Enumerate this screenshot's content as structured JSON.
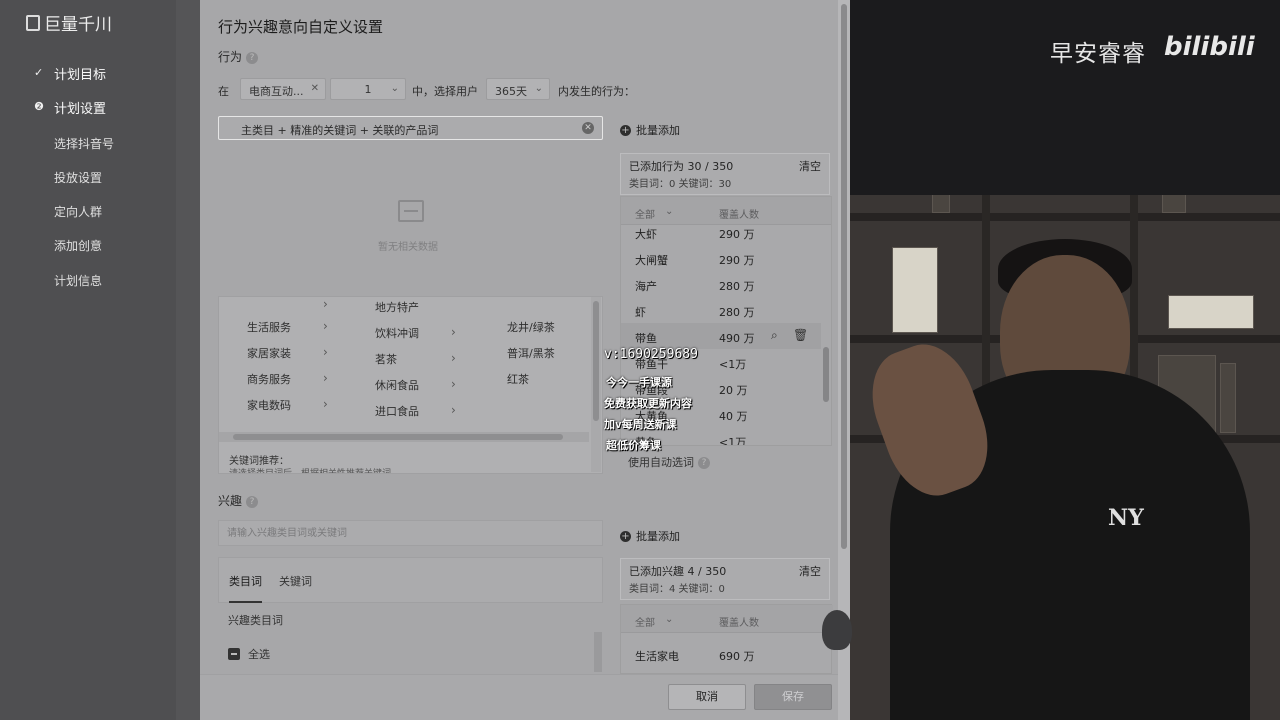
{
  "app": {
    "logo": "巨量千川",
    "nav": [
      {
        "label": "计划目标",
        "icon": "check-icon"
      },
      {
        "label": "计划设置",
        "icon": "step-2-icon"
      },
      {
        "label": "选择抖音号"
      },
      {
        "label": "投放设置"
      },
      {
        "label": "定向人群"
      },
      {
        "label": "添加创意"
      },
      {
        "label": "计划信息"
      }
    ]
  },
  "modal": {
    "title": "行为兴趣意向自定义设置",
    "behavior": {
      "label": "行为",
      "prefix": "在",
      "scene_select": "电商互动...",
      "days_select": "1",
      "mid_text": "中，选择用户",
      "period_select": "365天",
      "suffix": "内发生的行为：",
      "keyword_value": "主类目 + 精准的关键词 + 关联的产品词",
      "batch_add": "批量添加",
      "empty_text": "暂无相关数据",
      "categories": {
        "col1": [
          "生活服务",
          "家居家装",
          "商务服务",
          "家电数码"
        ],
        "col2": [
          "地方特产",
          "饮料冲调",
          "茗茶",
          "休闲食品",
          "进口食品"
        ],
        "col3": [
          "龙井/绿茶",
          "普洱/黑茶",
          "红茶"
        ]
      },
      "kw_rec_label": "关键词推荐：",
      "kw_rec_sub": "请选择类目词后，根据相关性推荐关键词",
      "summary": {
        "title": "已添加行为 30 / 350",
        "clear": "清空",
        "sub": "类目词：0   关键词：30"
      },
      "list_header": {
        "all": "全部",
        "coverage": "覆盖人数"
      },
      "items": [
        {
          "name": "大虾",
          "coverage": "290 万"
        },
        {
          "name": "大闸蟹",
          "coverage": "290 万"
        },
        {
          "name": "海产",
          "coverage": "280 万"
        },
        {
          "name": "虾",
          "coverage": "280 万"
        },
        {
          "name": "带鱼",
          "coverage": "490 万"
        },
        {
          "name": "带鱼干",
          "coverage": "<1万"
        },
        {
          "name": "带鱼段",
          "coverage": "20 万"
        },
        {
          "name": "大黄鱼",
          "coverage": "40 万"
        },
        {
          "name": "黄鱼",
          "coverage": "<1万"
        }
      ],
      "auto_words": "使用自动选词"
    },
    "interest": {
      "label": "兴趣",
      "placeholder": "请输入兴趣类目词或关键词",
      "batch_add": "批量添加",
      "tabs": [
        "类目词",
        "关键词"
      ],
      "cat_label": "兴趣类目词",
      "select_all": "全选",
      "summary": {
        "title": "已添加兴趣 4 / 350",
        "clear": "清空",
        "sub": "类目词：4   关键词：0"
      },
      "list_header": {
        "all": "全部",
        "coverage": "覆盖人数"
      },
      "items": [
        {
          "name": "生活家电",
          "coverage": "690 万"
        }
      ]
    },
    "footer": {
      "cancel": "取消",
      "save": "保存"
    }
  },
  "watermark": {
    "id": "v:1690259689",
    "lines": [
      "今今一手课源",
      "免费获取更新内容",
      "加v每周送新课",
      "超低价筹课"
    ]
  },
  "video": {
    "channel": "早安睿睿",
    "platform": "bilibili"
  }
}
